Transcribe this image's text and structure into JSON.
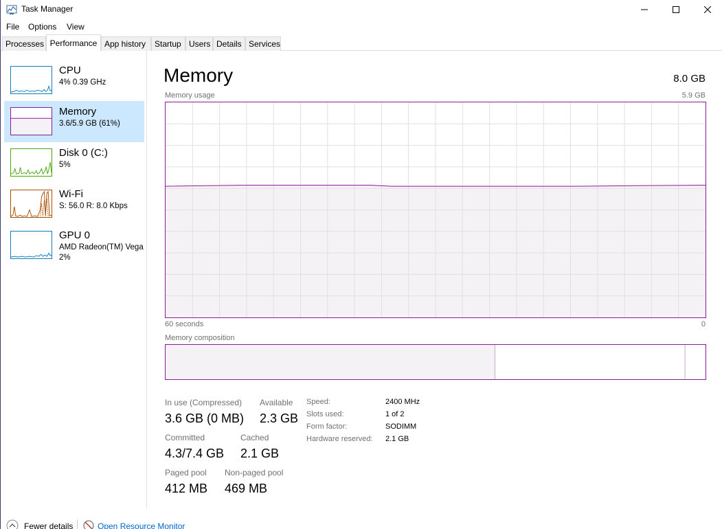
{
  "window": {
    "title": "Task Manager"
  },
  "menu": {
    "file": "File",
    "options": "Options",
    "view": "View"
  },
  "tabs": [
    "Processes",
    "Performance",
    "App history",
    "Startup",
    "Users",
    "Details",
    "Services"
  ],
  "active_tab": "Performance",
  "sidebar": {
    "items": [
      {
        "name": "CPU",
        "sub": "4%  0.39 GHz",
        "sub2": "",
        "color": "#117dbb"
      },
      {
        "name": "Memory",
        "sub": "3.6/5.9 GB (61%)",
        "sub2": "",
        "color": "#8b1a9b",
        "selected": true
      },
      {
        "name": "Disk 0 (C:)",
        "sub": "5%",
        "sub2": "",
        "color": "#4da60c"
      },
      {
        "name": "Wi-Fi",
        "sub": "S: 56.0  R: 8.0 Kbps",
        "sub2": "",
        "color": "#a74f01"
      },
      {
        "name": "GPU 0",
        "sub": "AMD Radeon(TM) Vega",
        "sub2": "2%",
        "color": "#117dbb"
      }
    ]
  },
  "main": {
    "title": "Memory",
    "total": "8.0 GB",
    "usage_label": "Memory usage",
    "usage_max": "5.9 GB",
    "time_left": "60 seconds",
    "time_right": "0",
    "composition_label": "Memory composition",
    "usage_fraction": 0.61,
    "composition": {
      "in_use_fraction": 0.61,
      "available_end_fraction": 0.962
    }
  },
  "stats": {
    "in_use_label": "In use (Compressed)",
    "in_use": "3.6 GB (0 MB)",
    "available_label": "Available",
    "available": "2.3 GB",
    "committed_label": "Committed",
    "committed": "4.3/7.4 GB",
    "cached_label": "Cached",
    "cached": "2.1 GB",
    "paged_label": "Paged pool",
    "paged": "412 MB",
    "nonpaged_label": "Non-paged pool",
    "nonpaged": "469 MB"
  },
  "details": {
    "speed_label": "Speed:",
    "speed": "2400 MHz",
    "slots_label": "Slots used:",
    "slots": "1 of 2",
    "form_label": "Form factor:",
    "form": "SODIMM",
    "reserved_label": "Hardware reserved:",
    "reserved": "2.1 GB"
  },
  "footer": {
    "fewer": "Fewer details",
    "link": "Open Resource Monitor"
  },
  "colors": {
    "memory": "#8b1a9b",
    "memory_fill": "#f4f2f4",
    "selected_bg": "#cce8ff",
    "link": "#0066cc"
  }
}
